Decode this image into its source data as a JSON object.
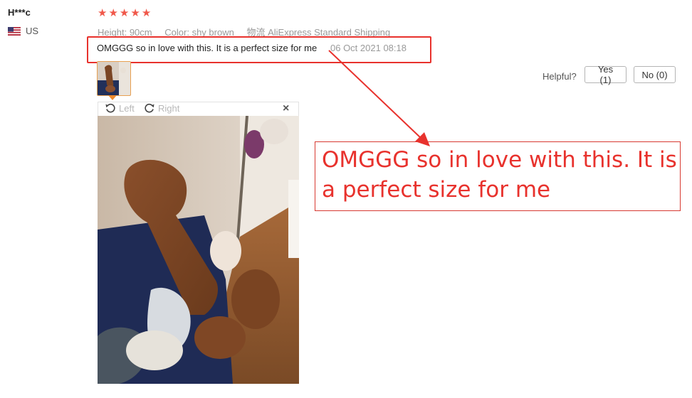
{
  "reviewer": {
    "name": "H***c",
    "country": "US"
  },
  "rating": {
    "stars": 5,
    "star_glyph": "★"
  },
  "attributes": [
    {
      "key": "Height:",
      "value": "90cm"
    },
    {
      "key": "Color:",
      "value": "shy brown"
    },
    {
      "key": "物流",
      "value": "AliExpress Standard Shipping"
    }
  ],
  "review": {
    "text": "OMGGG so in love with this. It is a perfect size for me",
    "date": "06 Oct 2021 08:18"
  },
  "helpful": {
    "label": "Helpful?",
    "yes": "Yes (1)",
    "no": "No (0)"
  },
  "image_viewer": {
    "rotate_left": "Left",
    "rotate_right": "Right",
    "close": "×"
  },
  "callout": {
    "text": "OMGGG so in love with this. It is a perfect size for me"
  },
  "colors": {
    "star": "#f0584a",
    "highlight_red": "#e8322d",
    "thumb_border": "#e8a051"
  }
}
